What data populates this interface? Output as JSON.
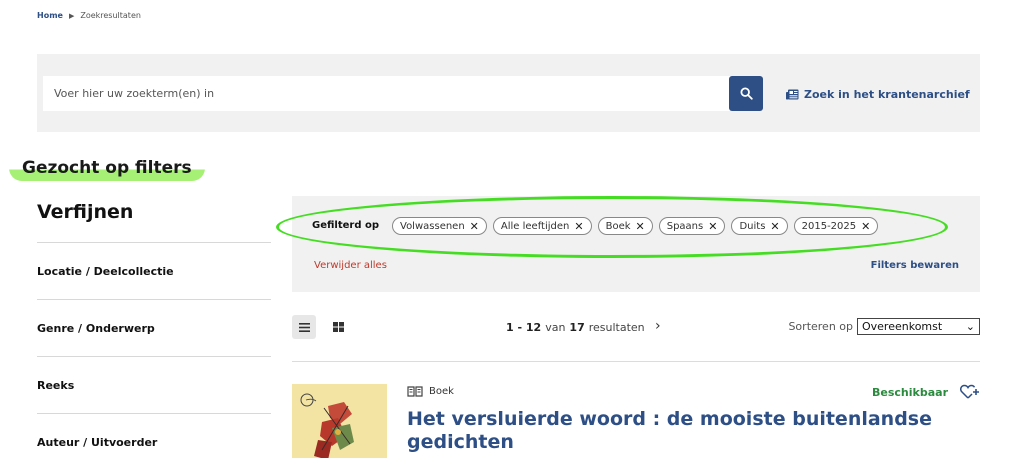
{
  "breadcrumb": {
    "home": "Home",
    "current": "Zoekresultaten"
  },
  "search": {
    "placeholder": "Voer hier uw zoekterm(en) in",
    "archive_link": "Zoek in het krantenarchief"
  },
  "filter_heading": "Gezocht op filters",
  "refine": {
    "title": "Verfijnen",
    "facets": [
      "Locatie / Deelcollectie",
      "Genre / Onderwerp",
      "Reeks",
      "Auteur / Uitvoerder"
    ]
  },
  "filters": {
    "label": "Gefilterd op",
    "chips": [
      "Volwassenen",
      "Alle leeftijden",
      "Boek",
      "Spaans",
      "Duits",
      "2015-2025"
    ],
    "remove_all": "Verwijder alles",
    "save": "Filters bewaren"
  },
  "results": {
    "range": "1 - 12",
    "of_word": "van",
    "total": "17",
    "results_word": "resultaten",
    "sort_label": "Sorteren op",
    "sort_value": "Overeenkomst"
  },
  "item": {
    "type": "Boek",
    "availability": "Beschikbaar",
    "title": "Het versluierde woord : de mooiste buitenlandse gedichten"
  },
  "colors": {
    "primary": "#2d4f86",
    "available": "#2b8a3e",
    "remove": "#c0392b",
    "highlight": "#a5f075",
    "annotation": "#44dd22"
  }
}
